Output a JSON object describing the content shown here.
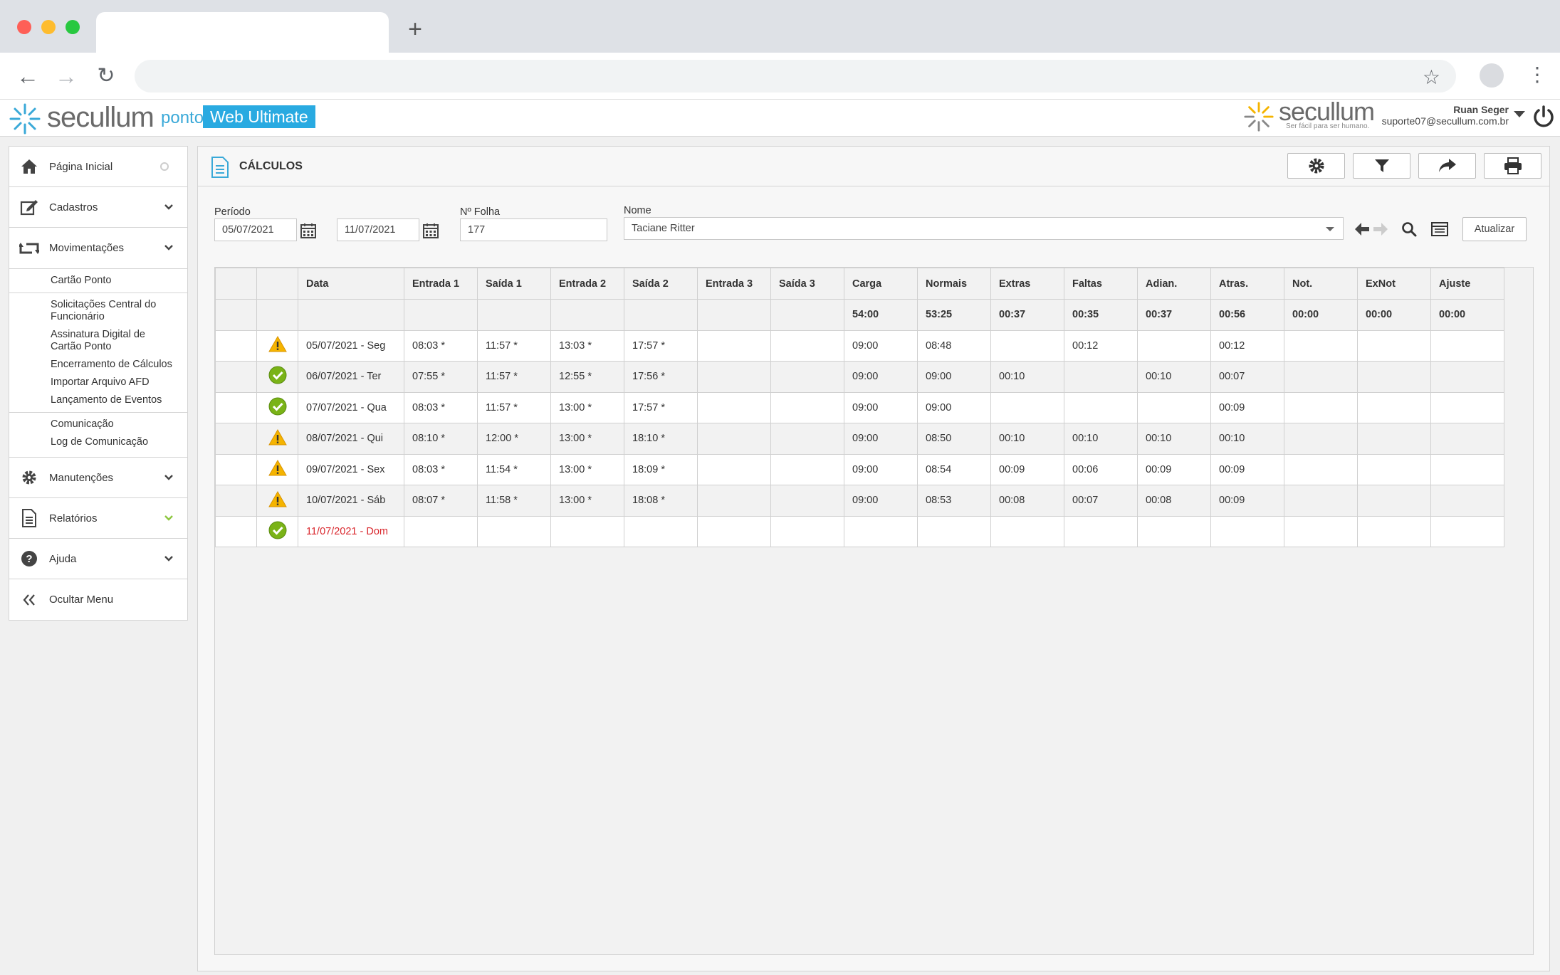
{
  "app": {
    "brand": "secullum",
    "brand_ponto": "ponto",
    "brand_edition": "Web Ultimate",
    "right_brand": "secullum",
    "right_tagline": "Ser fácil para ser humano.",
    "user_name": "Ruan Seger",
    "user_email": "suporte07@secullum.com.br"
  },
  "sidebar": {
    "home": "Página Inicial",
    "cadastros": "Cadastros",
    "movimentacoes": "Movimentações",
    "sub_items": [
      "Cartão Ponto",
      "Solicitações Central do Funcionário",
      "Assinatura Digital de Cartão Ponto",
      "Encerramento de Cálculos",
      "Importar Arquivo AFD",
      "Lançamento de Eventos",
      "Comunicação",
      "Log de Comunicação"
    ],
    "manutencoes": "Manutenções",
    "relatorios": "Relatórios",
    "ajuda": "Ajuda",
    "ocultar": "Ocultar Menu"
  },
  "main": {
    "title": "CÁLCULOS",
    "periodo_label": "Período",
    "periodo_inicio": "05/07/2021",
    "periodo_fim": "11/07/2021",
    "folha_label": "Nº Folha",
    "folha_value": "177",
    "nome_label": "Nome",
    "nome_value": "Taciane Ritter",
    "atualizar": "Atualizar"
  },
  "table": {
    "columns": [
      "Data",
      "Entrada 1",
      "Saída 1",
      "Entrada 2",
      "Saída 2",
      "Entrada 3",
      "Saída 3",
      "Carga",
      "Normais",
      "Extras",
      "Faltas",
      "Adian.",
      "Atras.",
      "Not.",
      "ExNot",
      "Ajuste"
    ],
    "totals": [
      "",
      "",
      "",
      "",
      "",
      "",
      "",
      "54:00",
      "53:25",
      "00:37",
      "00:35",
      "00:37",
      "00:56",
      "00:00",
      "00:00",
      "00:00"
    ],
    "rows": [
      {
        "status": "warning",
        "cells": [
          "05/07/2021 - Seg",
          "08:03 *",
          "11:57 *",
          "13:03 *",
          "17:57 *",
          "",
          "",
          "09:00",
          "08:48",
          "",
          "00:12",
          "",
          "00:12",
          "",
          "",
          ""
        ]
      },
      {
        "status": "ok",
        "cells": [
          "06/07/2021 - Ter",
          "07:55 *",
          "11:57 *",
          "12:55 *",
          "17:56 *",
          "",
          "",
          "09:00",
          "09:00",
          "00:10",
          "",
          "00:10",
          "00:07",
          "",
          "",
          ""
        ]
      },
      {
        "status": "ok",
        "cells": [
          "07/07/2021 - Qua",
          "08:03 *",
          "11:57 *",
          "13:00 *",
          "17:57 *",
          "",
          "",
          "09:00",
          "09:00",
          "",
          "",
          "",
          "00:09",
          "",
          "",
          ""
        ]
      },
      {
        "status": "warning",
        "cells": [
          "08/07/2021 - Qui",
          "08:10 *",
          "12:00 *",
          "13:00 *",
          "18:10 *",
          "",
          "",
          "09:00",
          "08:50",
          "00:10",
          "00:10",
          "00:10",
          "00:10",
          "",
          "",
          ""
        ]
      },
      {
        "status": "warning",
        "cells": [
          "09/07/2021 - Sex",
          "08:03 *",
          "11:54 *",
          "13:00 *",
          "18:09 *",
          "",
          "",
          "09:00",
          "08:54",
          "00:09",
          "00:06",
          "00:09",
          "00:09",
          "",
          "",
          ""
        ]
      },
      {
        "status": "warning",
        "cells": [
          "10/07/2021 - Sáb",
          "08:07 *",
          "11:58 *",
          "13:00 *",
          "18:08 *",
          "",
          "",
          "09:00",
          "08:53",
          "00:08",
          "00:07",
          "00:08",
          "00:09",
          "",
          "",
          ""
        ]
      },
      {
        "status": "ok",
        "holiday": true,
        "cells": [
          "11/07/2021 - Dom",
          "",
          "",
          "",
          "",
          "",
          "",
          "",
          "",
          "",
          "",
          "",
          "",
          "",
          "",
          ""
        ]
      }
    ]
  },
  "colors": {
    "accent": "#29aae1",
    "warning": "#f5b400",
    "ok": "#7ab317",
    "sunday": "#d9262c"
  }
}
